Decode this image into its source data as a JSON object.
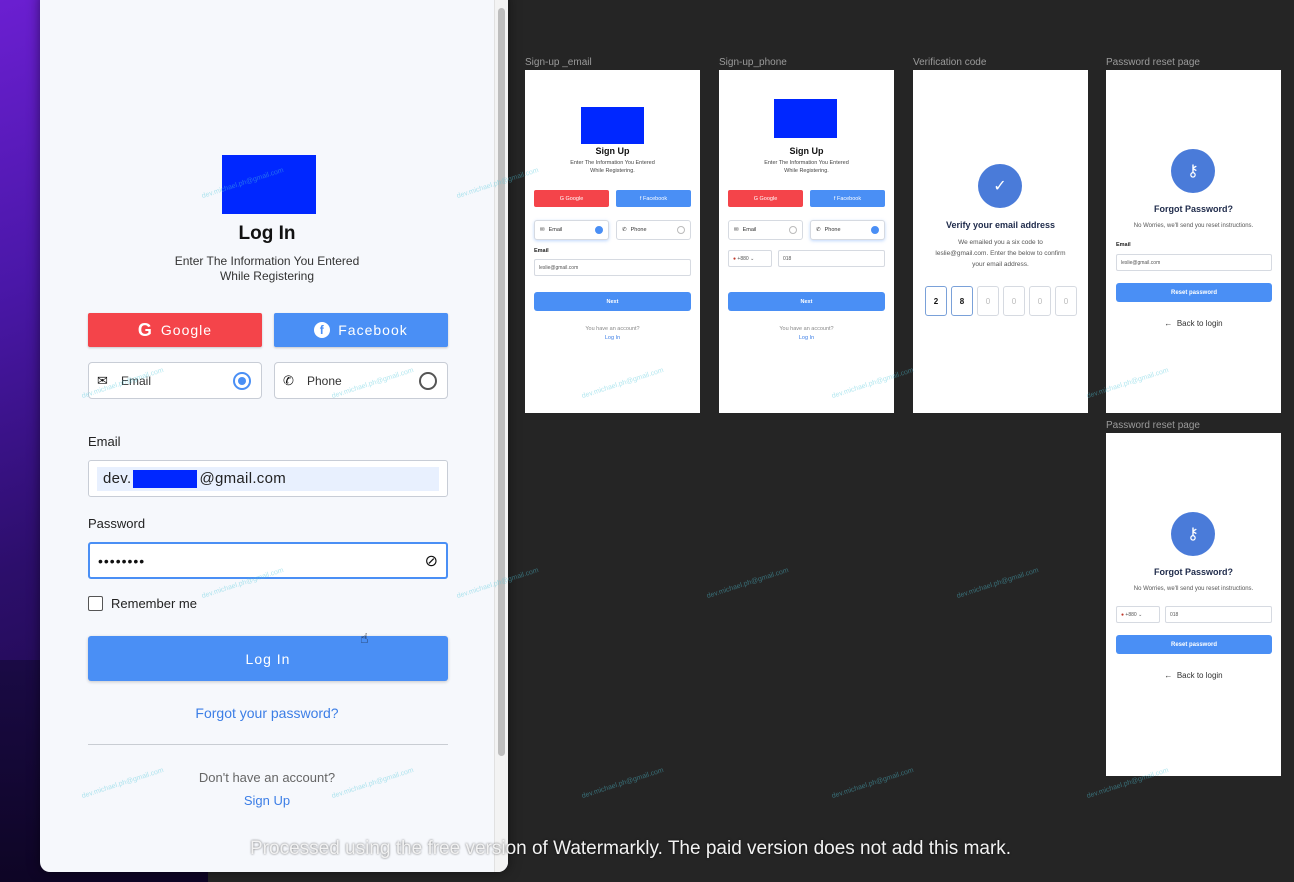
{
  "login": {
    "title": "Log In",
    "subtitle_line1": "Enter The Information You Entered",
    "subtitle_line2": "While Registering",
    "google_label": "Google",
    "facebook_label": "Facebook",
    "method_email": "Email",
    "method_phone": "Phone",
    "email_label": "Email",
    "email_value_prefix": "dev.",
    "email_value_suffix": "@gmail.com",
    "password_label": "Password",
    "password_value": "••••••••",
    "remember_label": "Remember me",
    "login_button": "Log In",
    "forgot_link": "Forgot your password?",
    "no_account": "Don't have an account?",
    "signup_link": "Sign Up"
  },
  "frames": {
    "signup_email": {
      "label": "Sign-up _email",
      "title": "Sign Up",
      "sub1": "Enter The Information You Entered",
      "sub2": "While Registering.",
      "google": "Google",
      "facebook": "Facebook",
      "email": "Email",
      "phone": "Phone",
      "field_label": "Email",
      "field_value": "leslie@gmail.com",
      "next": "Next",
      "have_account": "You have an account?",
      "login": "Log In"
    },
    "signup_phone": {
      "label": "Sign-up_phone",
      "title": "Sign Up",
      "sub1": "Enter The Information You Entered",
      "sub2": "While Registering.",
      "google": "Google",
      "facebook": "Facebook",
      "email": "Email",
      "phone": "Phone",
      "country_code": "+880",
      "phone_value": "018",
      "next": "Next",
      "have_account": "You have an account?",
      "login": "Log In"
    },
    "verification": {
      "label": "Verification code",
      "heading": "Verify your email address",
      "text1": "We emailed you a six code to",
      "text2": "leslie@gmail.com. Enter the below to confirm",
      "text3": "your email address.",
      "codes": [
        "2",
        "8",
        "0",
        "0",
        "0",
        "0"
      ]
    },
    "reset_email": {
      "label": "Password reset page",
      "heading": "Forgot Password?",
      "text": "No Worries, we'll send you reset instructions.",
      "field_label": "Email",
      "field_value": "leslie@gmail.com",
      "button": "Reset password",
      "back": "Back to login"
    },
    "reset_phone": {
      "label": "Password reset page",
      "heading": "Forgot Password?",
      "text": "No Worries, we'll send you reset instructions.",
      "country_code": "+880",
      "phone_value": "018",
      "button": "Reset password",
      "back": "Back to login"
    }
  },
  "watermark_notice": "Processed using the free version of Watermarkly. The paid version does not add this mark.",
  "watermark_text": "dev.michael.ph@gmail.com",
  "colors": {
    "google": "#f4444a",
    "primary": "#4a8ff5",
    "link": "#3c7ee6",
    "canvas": "#252525",
    "redaction": "#0027ff"
  }
}
